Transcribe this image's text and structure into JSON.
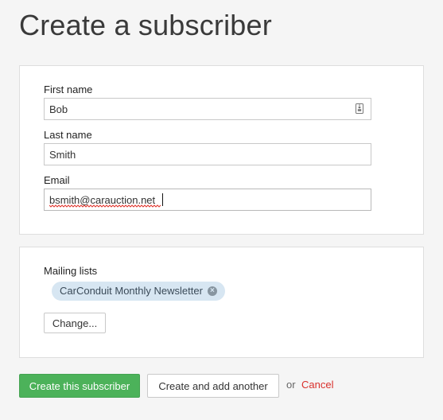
{
  "page": {
    "title": "Create a subscriber"
  },
  "details": {
    "first_name": {
      "label": "First name",
      "value": "Bob"
    },
    "last_name": {
      "label": "Last name",
      "value": "Smith"
    },
    "email": {
      "label": "Email",
      "value": "bsmith@carauction.net"
    }
  },
  "mailing_lists": {
    "label": "Mailing lists",
    "selected": [
      {
        "name": "CarConduit Monthly Newsletter"
      }
    ],
    "change_label": "Change..."
  },
  "actions": {
    "create_label": "Create this subscriber",
    "create_another_label": "Create and add another",
    "or_text": "or",
    "cancel_label": "Cancel"
  },
  "colors": {
    "primary_button": "#4cb25a",
    "cancel_link": "#d9302c",
    "chip_background": "#d7e6f2"
  },
  "icons": {
    "first_name_field": "contact-card-icon",
    "chip_remove": "remove-circle-icon"
  }
}
